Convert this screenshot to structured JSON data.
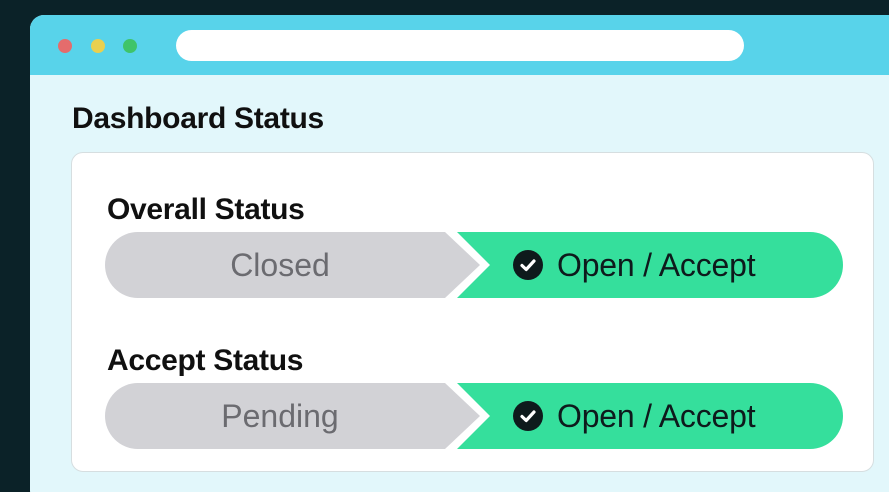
{
  "window": {
    "page_title": "Dashboard Status"
  },
  "sections": [
    {
      "label": "Overall Status",
      "inactive_option": "Closed",
      "active_option": "Open / Accept",
      "active_icon": "check-circle-icon"
    },
    {
      "label": "Accept Status",
      "inactive_option": "Pending",
      "active_option": "Open / Accept",
      "active_icon": "check-circle-icon"
    }
  ],
  "colors": {
    "titlebar": "#58d3ea",
    "active": "#35df9c",
    "inactive": "#d2d2d6"
  }
}
